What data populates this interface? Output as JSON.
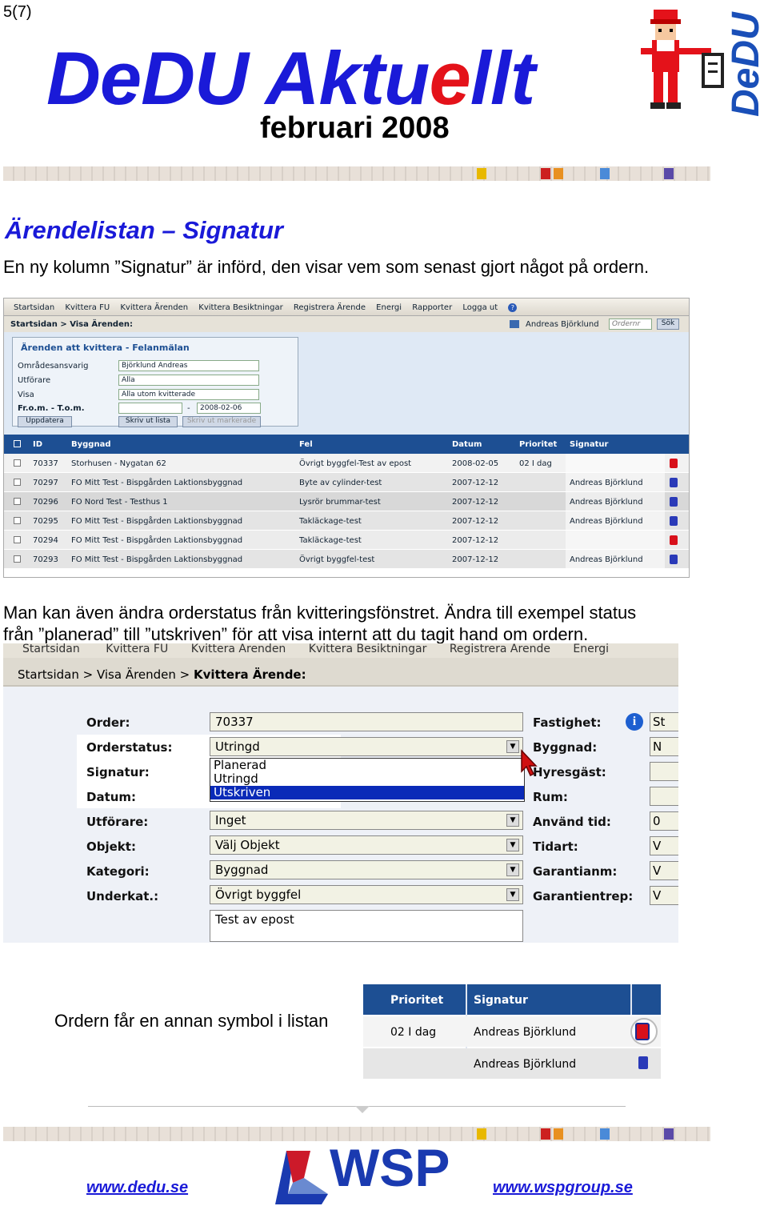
{
  "page_number": "5(7)",
  "header": {
    "title_part1": "De",
    "title_part2": "DU Aktu",
    "title_part3": "e",
    "title_part4": "llt",
    "subtitle": "februari 2008",
    "logo_text": "DeDU"
  },
  "section1": {
    "heading": "Ärendelistan – Signatur",
    "text": "En ny kolumn ”Signatur” är införd, den visar vem som senast gjort något på ordern."
  },
  "screenshot1": {
    "menu": [
      "Startsidan",
      "Kvittera FU",
      "Kvittera Ärenden",
      "Kvittera Besiktningar",
      "Registrera Ärende",
      "Energi",
      "Rapporter",
      "Logga ut"
    ],
    "breadcrumb": "Startsidan > Visa Ärenden:",
    "user": "Andreas Björklund",
    "order_placeholder": "Ordernr",
    "search_button": "Sök",
    "panel_title": "Ärenden att kvittera - Felanmälan",
    "filters": [
      {
        "label": "Områdesansvarig",
        "value": "Björklund Andreas"
      },
      {
        "label": "Utförare",
        "value": "Alla"
      },
      {
        "label": "Visa",
        "value": "Alla utom kvitterade"
      }
    ],
    "date_label": "Fr.o.m. - T.o.m.",
    "date_sep": "-",
    "date_to": "2008-02-06",
    "btn_update": "Uppdatera",
    "btn_print": "Skriv ut lista",
    "btn_print_marked": "Skriv ut markerade",
    "columns": [
      "ID",
      "Byggnad",
      "Fel",
      "Datum",
      "Prioritet",
      "Signatur"
    ],
    "rows": [
      {
        "id": "70337",
        "byggnad": "Storhusen - Nygatan 62",
        "fel": "Övrigt byggfel-Test av epost",
        "datum": "2008-02-05",
        "prioritet": "02 I dag",
        "signatur": "",
        "icon": "red"
      },
      {
        "id": "70297",
        "byggnad": "FO Mitt Test - Bispgården Laktionsbyggnad",
        "fel": "Byte av cylinder-test",
        "datum": "2007-12-12",
        "prioritet": "",
        "signatur": "Andreas Björklund",
        "icon": "blue"
      },
      {
        "id": "70296",
        "byggnad": "FO Nord Test - Testhus 1",
        "fel": "Lysrör brummar-test",
        "datum": "2007-12-12",
        "prioritet": "",
        "signatur": "Andreas Björklund",
        "icon": "blue"
      },
      {
        "id": "70295",
        "byggnad": "FO Mitt Test - Bispgården Laktionsbyggnad",
        "fel": "Takläckage-test",
        "datum": "2007-12-12",
        "prioritet": "",
        "signatur": "Andreas Björklund",
        "icon": "blue"
      },
      {
        "id": "70294",
        "byggnad": "FO Mitt Test - Bispgården Laktionsbyggnad",
        "fel": "Takläckage-test",
        "datum": "2007-12-12",
        "prioritet": "",
        "signatur": "",
        "icon": "red"
      },
      {
        "id": "70293",
        "byggnad": "FO Mitt Test - Bispgården Laktionsbyggnad",
        "fel": "Övrigt byggfel-test",
        "datum": "2007-12-12",
        "prioritet": "",
        "signatur": "Andreas Björklund",
        "icon": "blue"
      }
    ]
  },
  "section2": {
    "line1": "Man kan även ändra orderstatus från kvitteringsfönstret. Ändra till exempel status",
    "line2": "från ”planerad” till ”utskriven” för att visa internt att du tagit hand om ordern."
  },
  "screenshot2": {
    "menu": [
      "Startsidan",
      "Kvittera FU",
      "Kvittera Ärenden",
      "Kvittera Besiktningar",
      "Registrera Ärende",
      "Energi"
    ],
    "breadcrumb_prefix": "Startsidan > Visa Ärenden > ",
    "breadcrumb_current": "Kvittera Ärende:",
    "left_labels": [
      "Order:",
      "Orderstatus:",
      "Signatur:",
      "Datum:",
      "Utförare:",
      "Objekt:",
      "Kategori:",
      "Underkat.:"
    ],
    "order_value": "70337",
    "status_value": "Utringd",
    "dropdown_options": [
      "Planerad",
      "Utringd",
      "Utskriven"
    ],
    "utforare_value": "Inget",
    "objekt_value": "Välj Objekt",
    "kategori_value": "Byggnad",
    "underkat_value": "Övrigt byggfel",
    "description": "Test av epost",
    "right_labels": [
      "Fastighet:",
      "Byggnad:",
      "Hyresgäst:",
      "Rum:",
      "Använd tid:",
      "Tidart:",
      "Garantianm:",
      "Garantientrep:"
    ],
    "right_values": [
      "St",
      "N",
      "",
      "",
      "0",
      "V",
      "V",
      "V"
    ]
  },
  "section3": {
    "text": "Ordern får en annan symbol i listan",
    "columns": [
      "Prioritet",
      "Signatur"
    ],
    "rows": [
      {
        "prioritet": "02 I dag",
        "signatur": "Andreas Björklund",
        "icon": "red"
      },
      {
        "prioritet": "",
        "signatur": "Andreas Björklund",
        "icon": "blue"
      }
    ]
  },
  "footer": {
    "wsp_logo": "WSP",
    "link_left": "www.dedu.se",
    "link_right": "www.wspgroup.se"
  },
  "colors": {
    "blue": "#1a1ad8",
    "red": "#e4121a",
    "table_header": "#1d4f93"
  }
}
